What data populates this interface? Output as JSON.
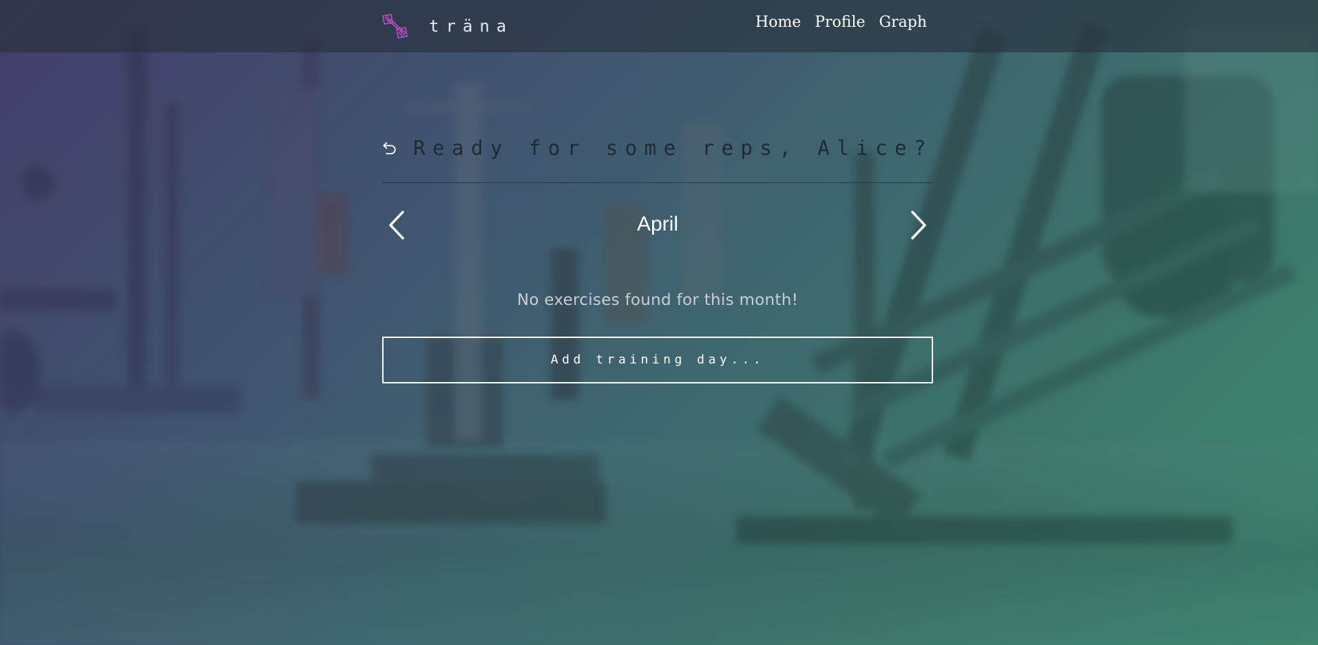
{
  "app": {
    "brand_name": "träna",
    "logo_icon": "dumbbell-icon",
    "accent_color": "#c04bc8"
  },
  "nav": {
    "links": [
      {
        "label": "Home"
      },
      {
        "label": "Profile"
      },
      {
        "label": "Graph"
      }
    ]
  },
  "main": {
    "back_icon": "undo-arrow-icon",
    "greeting": "Ready for some reps, Alice?",
    "month": {
      "label": "April",
      "prev_icon": "chevron-left-icon",
      "next_icon": "chevron-right-icon"
    },
    "empty_message": "No exercises found for this month!",
    "add_button_label": "Add training day..."
  }
}
